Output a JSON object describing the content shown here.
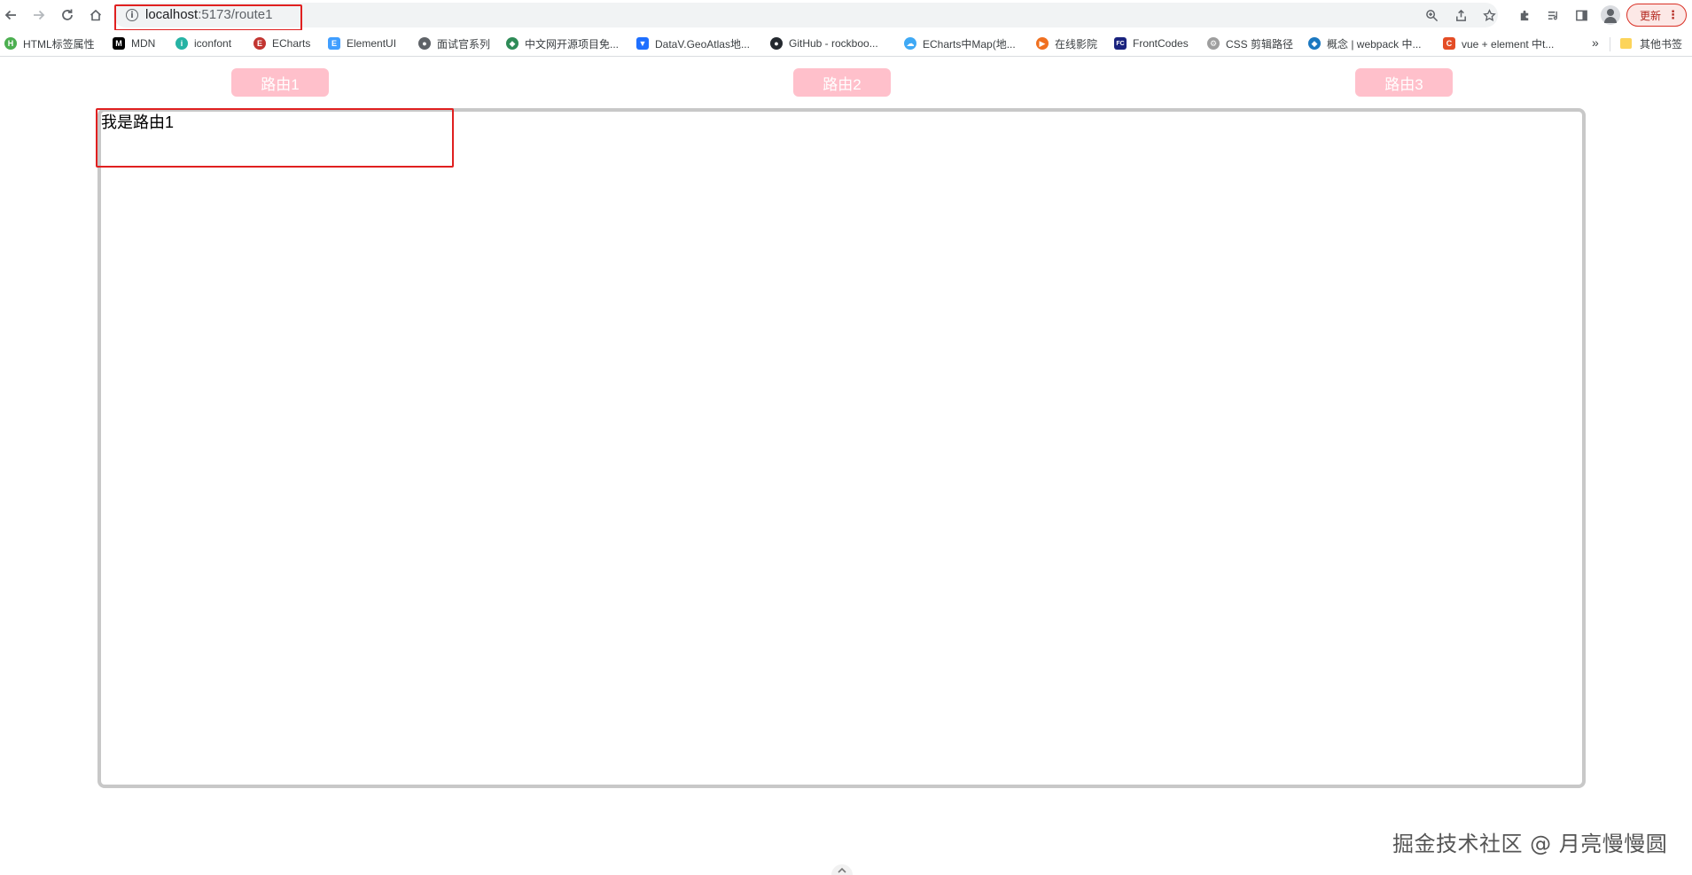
{
  "browser": {
    "url_host": "localhost",
    "url_path": ":5173/route1",
    "update_label": "更新",
    "icons": {
      "back": "arrow-left-icon",
      "forward": "arrow-right-icon",
      "reload": "reload-icon",
      "home": "home-icon",
      "site_info": "info-icon",
      "zoom": "zoom-icon",
      "share": "share-icon",
      "bookmark": "star-icon",
      "extensions": "puzzle-icon",
      "reading_list": "reading-list-icon",
      "side_panel": "side-panel-icon",
      "profile": "avatar-icon",
      "menu": "kebab-menu-icon"
    }
  },
  "bookmarks": [
    {
      "label": "HTML标签属性",
      "color": "#4caf50",
      "glyph": "H"
    },
    {
      "label": "MDN",
      "color": "#000000",
      "glyph": "M"
    },
    {
      "label": "iconfont",
      "color": "#26b3a4",
      "glyph": "i"
    },
    {
      "label": "ECharts",
      "color": "#c23531",
      "glyph": "E"
    },
    {
      "label": "ElementUI",
      "color": "#409eff",
      "glyph": "E"
    },
    {
      "label": "面试官系列",
      "color": "#5f6368",
      "glyph": "●"
    },
    {
      "label": "中文网开源项目免...",
      "color": "#2e8b57",
      "glyph": "◆"
    },
    {
      "label": "DataV.GeoAtlas地...",
      "color": "#1e6fff",
      "glyph": "▼"
    },
    {
      "label": "GitHub - rockboo...",
      "color": "#24292f",
      "glyph": "●"
    },
    {
      "label": "ECharts中Map(地...",
      "color": "#3fa9f5",
      "glyph": "☁"
    },
    {
      "label": "在线影院",
      "color": "#f07020",
      "glyph": "▶"
    },
    {
      "label": "FrontCodes",
      "color": "#1a237e",
      "glyph": "FC"
    },
    {
      "label": "CSS 剪辑路径",
      "color": "#9e9e9e",
      "glyph": "⚙"
    },
    {
      "label": "概念 | webpack 中...",
      "color": "#1c78c0",
      "glyph": "◆"
    },
    {
      "label": "vue + element 中t...",
      "color": "#e44d26",
      "glyph": "C"
    }
  ],
  "bookmarks_more": "»",
  "other_bookmarks": "其他书签",
  "routes": [
    {
      "label": "路由1"
    },
    {
      "label": "路由2"
    },
    {
      "label": "路由3"
    }
  ],
  "view": {
    "text": "我是路由1"
  },
  "watermark": "掘金技术社区 @ 月亮慢慢圆",
  "colors": {
    "route_button": "#ffc0cb",
    "view_border": "#c8c8c8",
    "annotation": "#e02020"
  }
}
